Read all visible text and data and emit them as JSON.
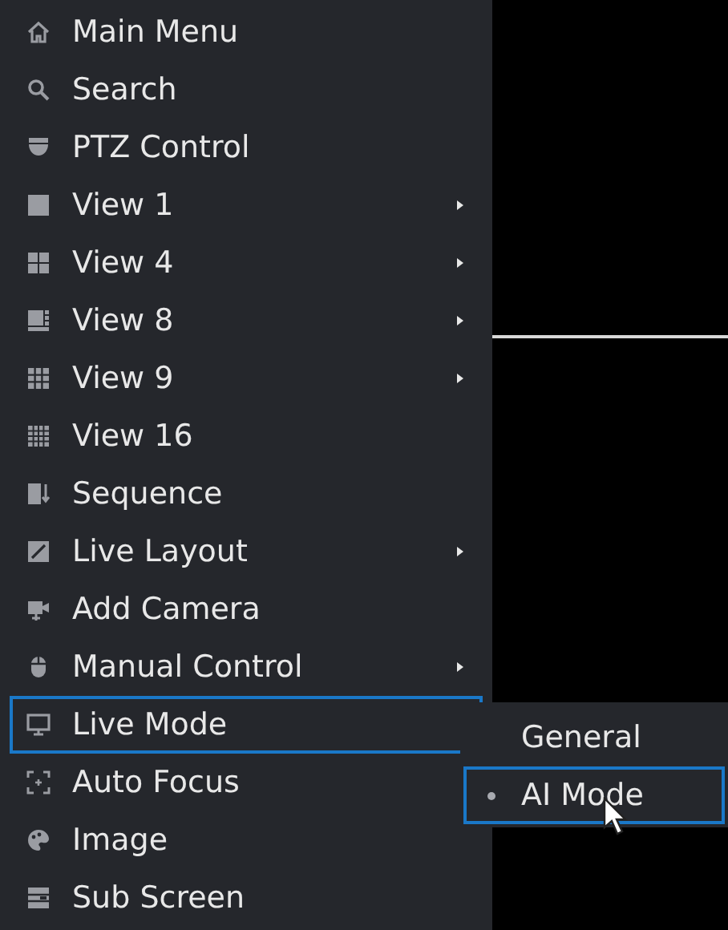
{
  "menu": {
    "items": [
      {
        "label": "Main Menu",
        "has_submenu": false,
        "focused": false
      },
      {
        "label": "Search",
        "has_submenu": false,
        "focused": false
      },
      {
        "label": "PTZ Control",
        "has_submenu": false,
        "focused": false
      },
      {
        "label": "View 1",
        "has_submenu": true,
        "focused": false
      },
      {
        "label": "View 4",
        "has_submenu": true,
        "focused": false
      },
      {
        "label": "View 8",
        "has_submenu": true,
        "focused": false
      },
      {
        "label": "View 9",
        "has_submenu": true,
        "focused": false
      },
      {
        "label": "View 16",
        "has_submenu": false,
        "focused": false
      },
      {
        "label": "Sequence",
        "has_submenu": false,
        "focused": false
      },
      {
        "label": "Live Layout",
        "has_submenu": true,
        "focused": false
      },
      {
        "label": "Add Camera",
        "has_submenu": false,
        "focused": false
      },
      {
        "label": "Manual Control",
        "has_submenu": true,
        "focused": false
      },
      {
        "label": "Live Mode",
        "has_submenu": false,
        "focused": true
      },
      {
        "label": "Auto Focus",
        "has_submenu": false,
        "focused": false
      },
      {
        "label": "Image",
        "has_submenu": false,
        "focused": false
      },
      {
        "label": "Sub Screen",
        "has_submenu": false,
        "focused": false
      }
    ]
  },
  "submenu": {
    "items": [
      {
        "label": "General",
        "selected": false,
        "focused": false
      },
      {
        "label": "AI Mode",
        "selected": true,
        "focused": true
      }
    ]
  }
}
